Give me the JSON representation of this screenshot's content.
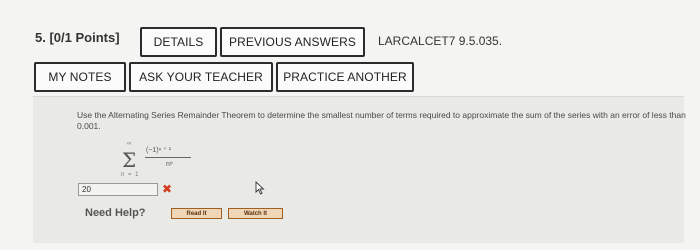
{
  "question": {
    "number_label": "5. [0/1 Points]",
    "code": "LARCALCET7 9.5.035.",
    "text": "Use the Alternating Series Remainder Theorem to determine the smallest number of terms required to approximate the sum of the series with an error of less than 0.001."
  },
  "top_buttons": {
    "details": "DETAILS",
    "previous_answers": "PREVIOUS ANSWERS"
  },
  "tools": {
    "my_notes": "MY NOTES",
    "ask_teacher": "ASK YOUR TEACHER",
    "practice_another": "PRACTICE ANOTHER"
  },
  "series": {
    "upper_limit": "∞",
    "lower_limit": "n = 1",
    "numerator": "(−1)ⁿ ⁺ ¹",
    "denominator": "n⁸"
  },
  "answer": {
    "value": "20",
    "status": "incorrect"
  },
  "help": {
    "label": "Need Help?",
    "read_it": "Read It",
    "watch_it": "Watch It"
  }
}
